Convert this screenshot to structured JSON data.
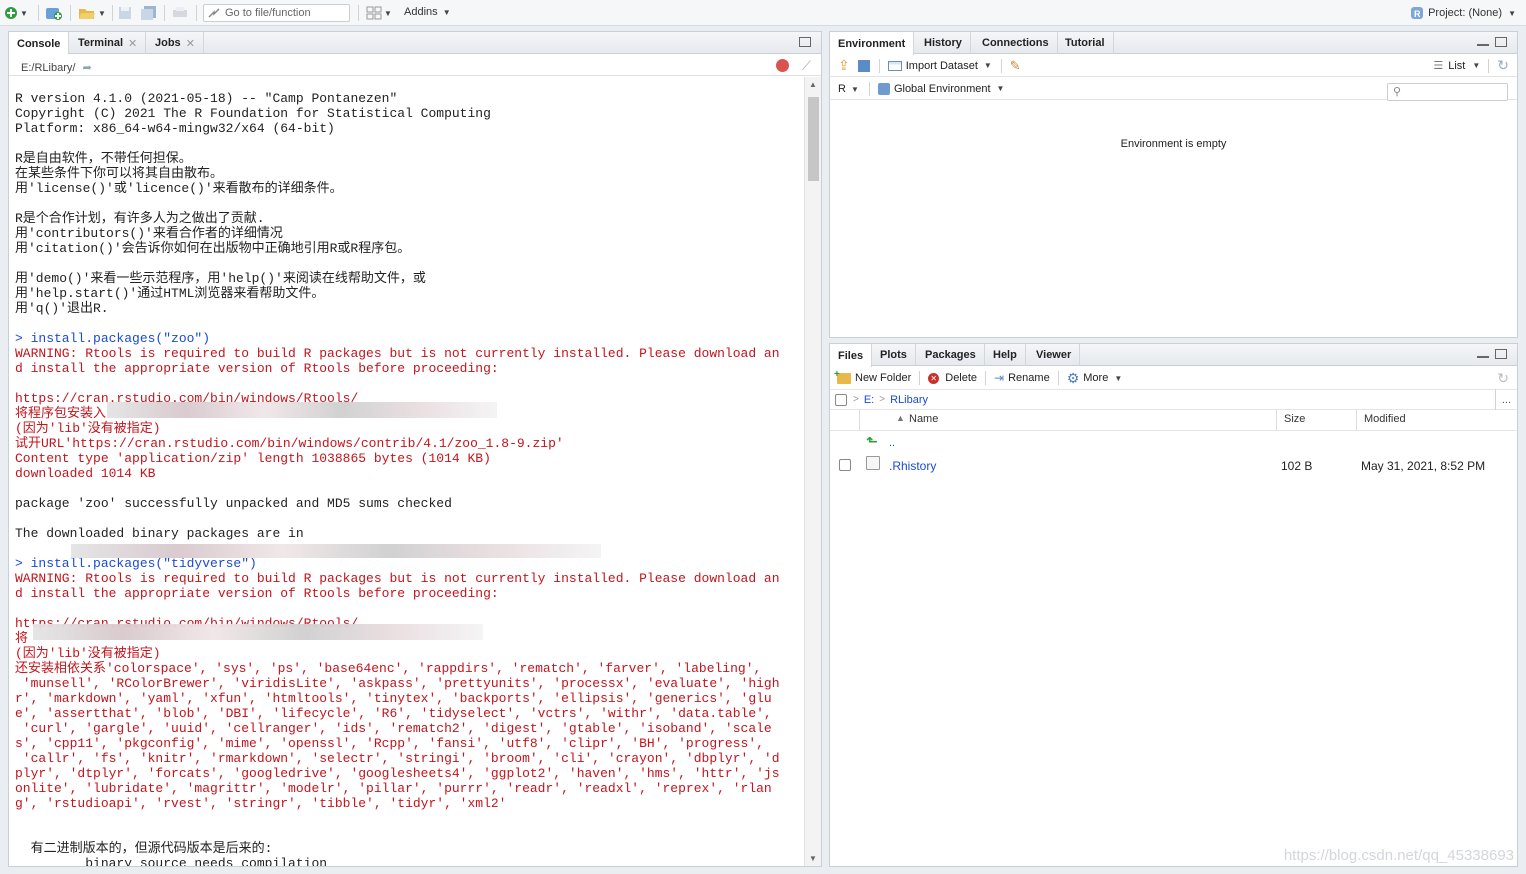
{
  "toolbar": {
    "goto_placeholder": "Go to file/function",
    "addins_label": "Addins",
    "project_label": "Project: (None)"
  },
  "console_pane": {
    "tabs": [
      {
        "label": "Console"
      },
      {
        "label": "Terminal"
      },
      {
        "label": "Jobs"
      }
    ],
    "path": "E:/RLibary/",
    "lines": [
      {
        "text": "R version 4.1.0 (2021-05-18) -- \"Camp Pontanezen\"",
        "color": "black"
      },
      {
        "text": "Copyright (C) 2021 The R Foundation for Statistical Computing",
        "color": "black"
      },
      {
        "text": "Platform: x86_64-w64-mingw32/x64 (64-bit)",
        "color": "black"
      },
      {
        "text": "",
        "color": "black"
      },
      {
        "text": "R是自由软件，不带任何担保。",
        "color": "black"
      },
      {
        "text": "在某些条件下你可以将其自由散布。",
        "color": "black"
      },
      {
        "text": "用'license()'或'licence()'来看散布的详细条件。",
        "color": "black"
      },
      {
        "text": "",
        "color": "black"
      },
      {
        "text": "R是个合作计划，有许多人为之做出了贡献.",
        "color": "black"
      },
      {
        "text": "用'contributors()'来看合作者的详细情况",
        "color": "black"
      },
      {
        "text": "用'citation()'会告诉你如何在出版物中正确地引用R或R程序包。",
        "color": "black"
      },
      {
        "text": "",
        "color": "black"
      },
      {
        "text": "用'demo()'来看一些示范程序，用'help()'来阅读在线帮助文件，或",
        "color": "black"
      },
      {
        "text": "用'help.start()'通过HTML浏览器来看帮助文件。",
        "color": "black"
      },
      {
        "text": "用'q()'退出R.",
        "color": "black"
      },
      {
        "text": "",
        "color": "black"
      },
      {
        "text": "> install.packages(\"zoo\")",
        "color": "blue"
      },
      {
        "text": "WARNING: Rtools is required to build R packages but is not currently installed. Please download an",
        "color": "red"
      },
      {
        "text": "d install the appropriate version of Rtools before proceeding:",
        "color": "red"
      },
      {
        "text": "",
        "color": "red"
      },
      {
        "text": "https://cran.rstudio.com/bin/windows/Rtools/",
        "color": "red"
      },
      {
        "text": "将程序包安装入",
        "color": "red"
      },
      {
        "text": "(因为'lib'没有被指定)",
        "color": "red"
      },
      {
        "text": "试开URL'https://cran.rstudio.com/bin/windows/contrib/4.1/zoo_1.8-9.zip'",
        "color": "red"
      },
      {
        "text": "Content type 'application/zip' length 1038865 bytes (1014 KB)",
        "color": "red"
      },
      {
        "text": "downloaded 1014 KB",
        "color": "red"
      },
      {
        "text": "",
        "color": "black"
      },
      {
        "text": "package 'zoo' successfully unpacked and MD5 sums checked",
        "color": "black"
      },
      {
        "text": "",
        "color": "black"
      },
      {
        "text": "The downloaded binary packages are in",
        "color": "black"
      },
      {
        "text": "",
        "color": "black"
      },
      {
        "text": "> install.packages(\"tidyverse\")",
        "color": "blue"
      },
      {
        "text": "WARNING: Rtools is required to build R packages but is not currently installed. Please download an",
        "color": "red"
      },
      {
        "text": "d install the appropriate version of Rtools before proceeding:",
        "color": "red"
      },
      {
        "text": "",
        "color": "red"
      },
      {
        "text": "https://cran.rstudio.com/bin/windows/Rtools/",
        "color": "red"
      },
      {
        "text": "将",
        "color": "red"
      },
      {
        "text": "(因为'lib'没有被指定)",
        "color": "red"
      },
      {
        "text": "还安装相依关系'colorspace', 'sys', 'ps', 'base64enc', 'rappdirs', 'rematch', 'farver', 'labeling',",
        "color": "red"
      },
      {
        "text": " 'munsell', 'RColorBrewer', 'viridisLite', 'askpass', 'prettyunits', 'processx', 'evaluate', 'high",
        "color": "red"
      },
      {
        "text": "r', 'markdown', 'yaml', 'xfun', 'htmltools', 'tinytex', 'backports', 'ellipsis', 'generics', 'glu",
        "color": "red"
      },
      {
        "text": "e', 'assertthat', 'blob', 'DBI', 'lifecycle', 'R6', 'tidyselect', 'vctrs', 'withr', 'data.table',",
        "color": "red"
      },
      {
        "text": " 'curl', 'gargle', 'uuid', 'cellranger', 'ids', 'rematch2', 'digest', 'gtable', 'isoband', 'scale",
        "color": "red"
      },
      {
        "text": "s', 'cpp11', 'pkgconfig', 'mime', 'openssl', 'Rcpp', 'fansi', 'utf8', 'clipr', 'BH', 'progress',",
        "color": "red"
      },
      {
        "text": " 'callr', 'fs', 'knitr', 'rmarkdown', 'selectr', 'stringi', 'broom', 'cli', 'crayon', 'dbplyr', 'd",
        "color": "red"
      },
      {
        "text": "plyr', 'dtplyr', 'forcats', 'googledrive', 'googlesheets4', 'ggplot2', 'haven', 'hms', 'httr', 'js",
        "color": "red"
      },
      {
        "text": "onlite', 'lubridate', 'magrittr', 'modelr', 'pillar', 'purrr', 'readr', 'readxl', 'reprex', 'rlan",
        "color": "red"
      },
      {
        "text": "g', 'rstudioapi', 'rvest', 'stringr', 'tibble', 'tidyr', 'xml2'",
        "color": "red"
      },
      {
        "text": "",
        "color": "black"
      },
      {
        "text": "",
        "color": "black"
      },
      {
        "text": "  有二进制版本的，但源代码版本是后来的:",
        "color": "black"
      },
      {
        "text": "         binary source needs_compilation",
        "color": "black"
      }
    ]
  },
  "env_pane": {
    "tabs": [
      {
        "label": "Environment"
      },
      {
        "label": "History"
      },
      {
        "label": "Connections"
      },
      {
        "label": "Tutorial"
      }
    ],
    "import_dataset_label": "Import Dataset",
    "list_label": "List",
    "lang_label": "R",
    "scope_label": "Global Environment",
    "empty_message": "Environment is empty"
  },
  "files_pane": {
    "tabs": [
      {
        "label": "Files"
      },
      {
        "label": "Plots"
      },
      {
        "label": "Packages"
      },
      {
        "label": "Help"
      },
      {
        "label": "Viewer"
      }
    ],
    "new_folder_label": "New Folder",
    "delete_label": "Delete",
    "rename_label": "Rename",
    "more_label": "More",
    "breadcrumb": {
      "drive": "E:",
      "folder": "RLibary"
    },
    "ellipsis": "...",
    "columns": {
      "name": "Name",
      "size": "Size",
      "modified": "Modified"
    },
    "up_label": "..",
    "rows": [
      {
        "name": ".Rhistory",
        "size": "102 B",
        "modified": "May 31, 2021, 8:52 PM"
      }
    ]
  },
  "watermark": "https://blog.csdn.net/qq_45338693",
  "colors": {
    "accent_blue": "#1a4ad6",
    "warning_red": "#c4141c"
  }
}
